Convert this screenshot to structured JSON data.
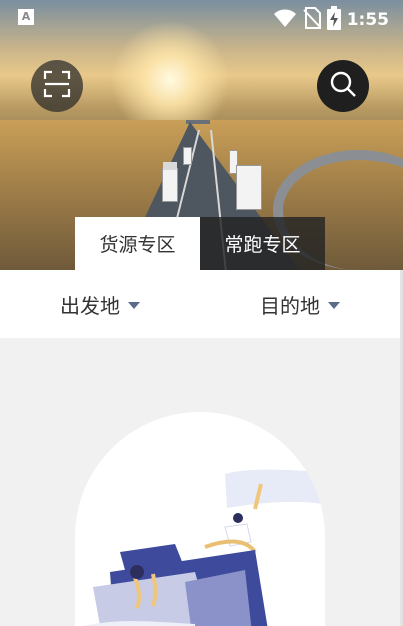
{
  "status_bar": {
    "left_badge": "A",
    "time": "1:55",
    "icons": [
      "wifi-icon",
      "no-sim-icon",
      "battery-charging-icon"
    ]
  },
  "header": {
    "scan_icon": "scan-icon",
    "search_icon": "search-icon"
  },
  "tabs": [
    {
      "label": "货源专区",
      "active": true
    },
    {
      "label": "常跑专区",
      "active": false
    }
  ],
  "filters": {
    "origin_label": "出发地",
    "destination_label": "目的地"
  },
  "empty_state": {
    "illustration": "empty-state-illustration"
  },
  "colors": {
    "caret": "#5a6c8c",
    "tab_active_bg": "#ffffff",
    "tab_inactive_bg": "#232323",
    "page_bg": "#f1f1f1",
    "illustration_primary": "#3e4a9c"
  }
}
